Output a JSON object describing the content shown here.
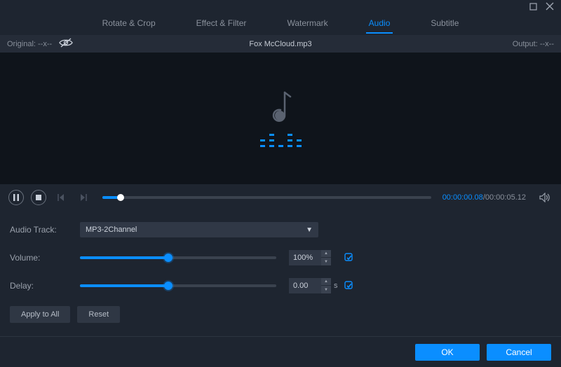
{
  "window": {
    "maximize_aria": "Maximize",
    "close_aria": "Close"
  },
  "tabs": {
    "rotate": "Rotate & Crop",
    "effect": "Effect & Filter",
    "watermark": "Watermark",
    "audio": "Audio",
    "subtitle": "Subtitle"
  },
  "infobar": {
    "original_label": "Original:",
    "original_value": "--x--",
    "filename": "Fox McCloud.mp3",
    "output_label": "Output:",
    "output_value": "--x--"
  },
  "transport": {
    "current": "00:00:00.08",
    "separator": "/",
    "total": "00:00:05.12"
  },
  "controls": {
    "audiotrack_label": "Audio Track:",
    "audiotrack_value": "MP3-2Channel",
    "volume_label": "Volume:",
    "volume_value": "100%",
    "delay_label": "Delay:",
    "delay_value": "0.00",
    "delay_unit": "s",
    "apply_all": "Apply to All",
    "reset": "Reset"
  },
  "footer": {
    "ok": "OK",
    "cancel": "Cancel"
  }
}
